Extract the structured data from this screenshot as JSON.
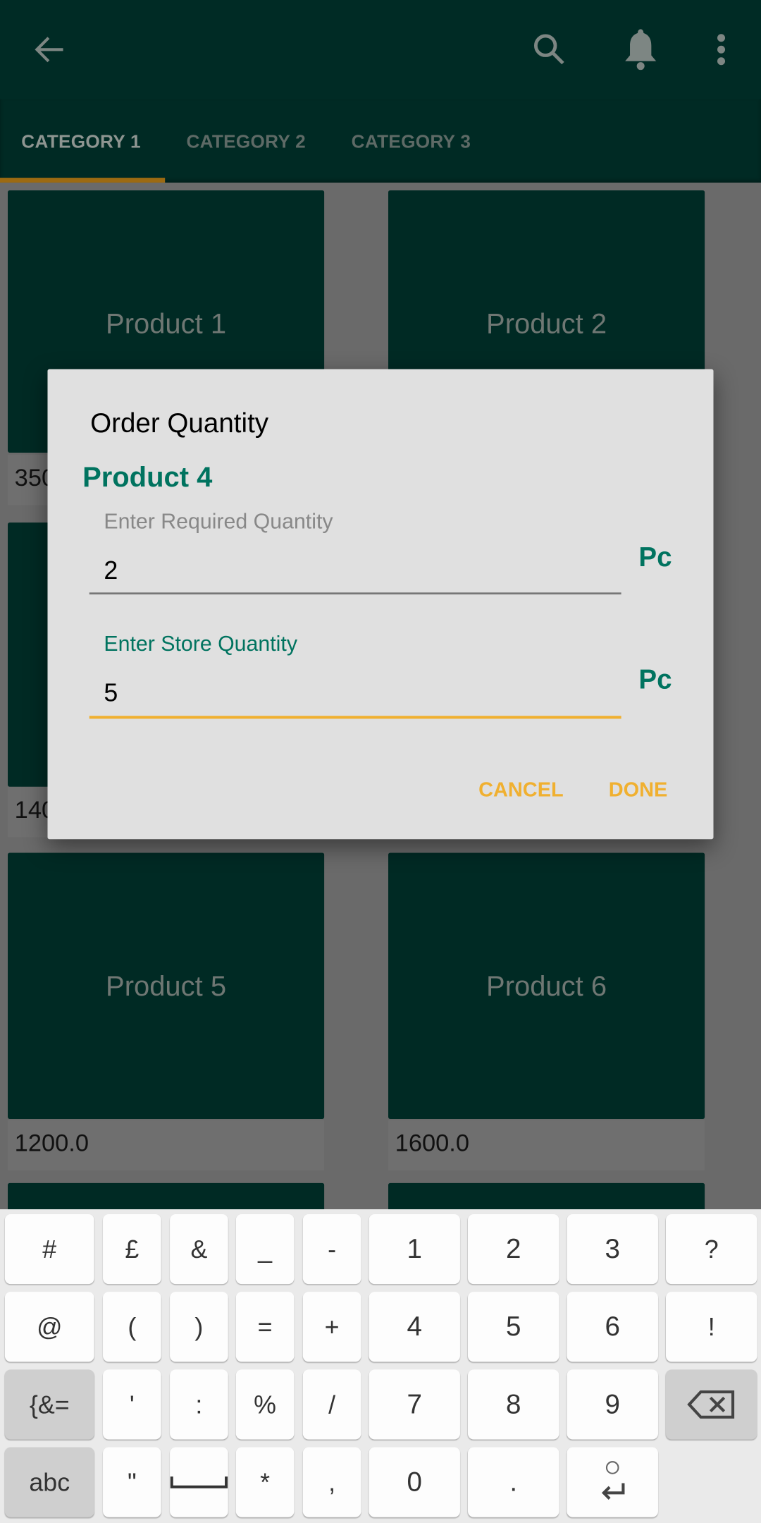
{
  "appbar": {
    "back_icon": "arrow-left",
    "search_icon": "magnifier",
    "notifications_icon": "bell",
    "more_icon": "vertical-dots"
  },
  "tabs": [
    {
      "label": "CATEGORY 1",
      "active": true
    },
    {
      "label": "CATEGORY 2",
      "active": false
    },
    {
      "label": "CATEGORY 3",
      "active": false
    }
  ],
  "products": [
    {
      "name": "Product 1",
      "price": "350"
    },
    {
      "name": "Product 2",
      "price": ""
    },
    {
      "name": "",
      "price": "140"
    },
    {
      "name": "",
      "price": ""
    },
    {
      "name": "Product 5",
      "price": "1200.0"
    },
    {
      "name": "Product 6",
      "price": "1600.0"
    }
  ],
  "dialog": {
    "title": "Order Quantity",
    "product": "Product 4",
    "required_label": "Enter Required Quantity",
    "required_value": "2",
    "store_label": "Enter Store Quantity",
    "store_value": "5",
    "unit": "Pc",
    "cancel": "CANCEL",
    "done": "DONE"
  },
  "keyboard": {
    "rows": [
      [
        "#",
        "£",
        "&",
        "_",
        "-",
        "1",
        "2",
        "3",
        "?"
      ],
      [
        "@",
        "(",
        ")",
        "=",
        "+",
        "4",
        "5",
        "6",
        "!"
      ],
      [
        "{&=",
        "'",
        ":",
        "%",
        "/",
        "7",
        "8",
        "9",
        "⌫"
      ],
      [
        "abc",
        "\"",
        "␣",
        "*",
        ",",
        "0",
        ".",
        "↵"
      ]
    ]
  },
  "colors": {
    "primary": "#00695c",
    "accent": "#f0b030",
    "dialog_bg": "#e0e0e0"
  }
}
